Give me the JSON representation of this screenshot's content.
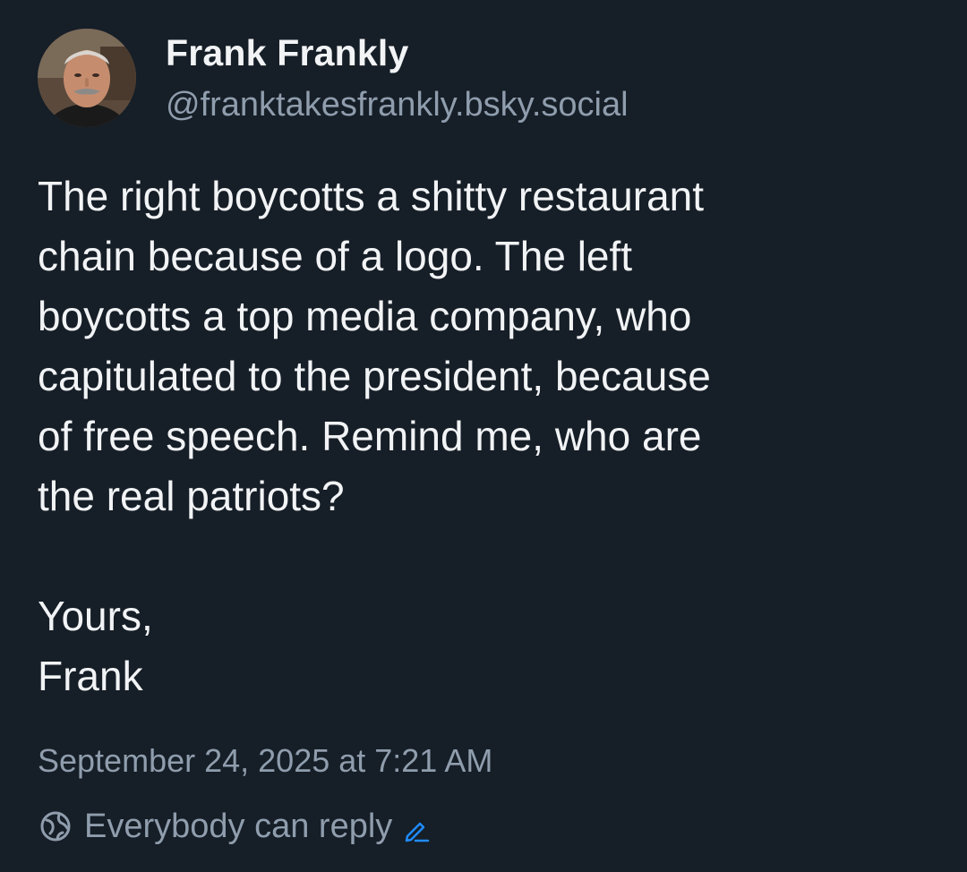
{
  "author": {
    "display_name": "Frank Frankly",
    "handle": "@franktakesfrankly.bsky.social",
    "avatar_icon": "profile-photo"
  },
  "post": {
    "text": "The right boycotts a shitty restaurant\nchain because of a logo. The left\nboycotts a top media company, who\ncapitulated to the president, because\nof free speech. Remind me, who are\nthe real patriots?\n\nYours,\nFrank",
    "timestamp": "September 24, 2025 at 7:21 AM"
  },
  "reply_settings": {
    "icon": "globe-icon",
    "label": "Everybody can reply",
    "edit_icon": "pencil-icon"
  },
  "colors": {
    "background": "#161e27",
    "primary_text": "#f1f3f5",
    "secondary_text": "#8f9dad",
    "accent": "#208bfe"
  }
}
